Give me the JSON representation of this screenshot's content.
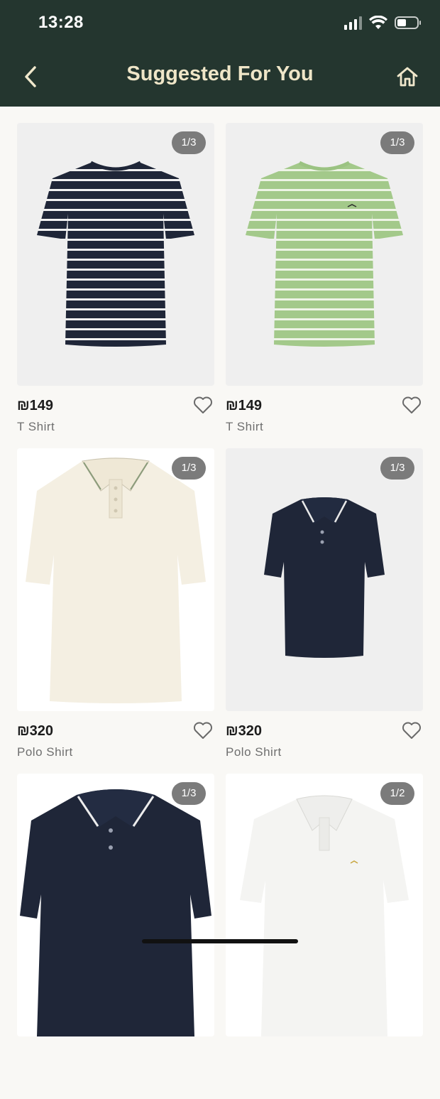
{
  "status_bar": {
    "time": "13:28"
  },
  "header": {
    "title": "Suggested For You"
  },
  "products": [
    {
      "price": "₪149",
      "name": "T Shirt",
      "badge": "1/3"
    },
    {
      "price": "₪149",
      "name": "T Shirt",
      "badge": "1/3"
    },
    {
      "price": "₪320",
      "name": "Polo Shirt",
      "badge": "1/3"
    },
    {
      "price": "₪320",
      "name": "Polo Shirt",
      "badge": "1/3"
    },
    {
      "price": "",
      "name": "",
      "badge": "1/3"
    },
    {
      "price": "",
      "name": "",
      "badge": "1/2"
    }
  ],
  "colors": {
    "header_bg": "#24362f",
    "title": "#efe6c8",
    "navy": "#1f2638",
    "sage": "#a3c98a",
    "cream": "#f4efe2"
  },
  "icons": [
    "back-chevron-icon",
    "home-icon",
    "heart-icon",
    "signal-icon",
    "wifi-icon",
    "battery-icon"
  ]
}
